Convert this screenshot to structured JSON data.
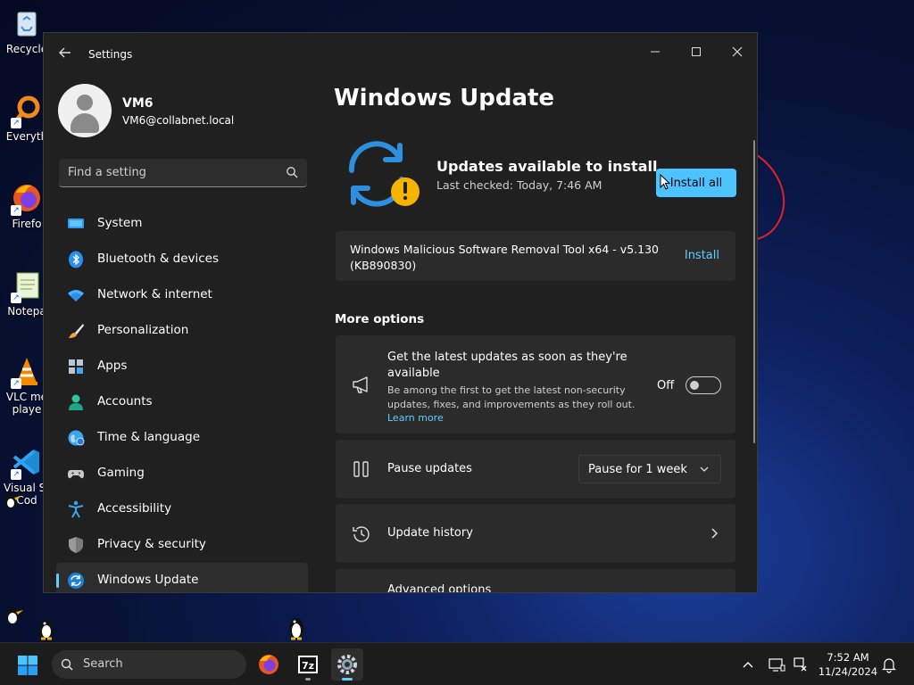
{
  "desktop": {
    "icons": [
      {
        "label": "Recycle"
      },
      {
        "label": "Everyth"
      },
      {
        "label": "Firefo"
      },
      {
        "label": "Notepa"
      },
      {
        "label": "VLC me\nplaye"
      },
      {
        "label": "Visual St\nCod"
      }
    ]
  },
  "window": {
    "title": "Settings",
    "controls": {
      "minimize": "—",
      "maximize": "☐",
      "close": "✕"
    }
  },
  "profile": {
    "name": "VM6",
    "email": "VM6@collabnet.local"
  },
  "search": {
    "placeholder": "Find a setting"
  },
  "nav": {
    "items": [
      {
        "label": "System",
        "icon": "system-icon"
      },
      {
        "label": "Bluetooth & devices",
        "icon": "bluetooth-icon"
      },
      {
        "label": "Network & internet",
        "icon": "wifi-icon"
      },
      {
        "label": "Personalization",
        "icon": "brush-icon"
      },
      {
        "label": "Apps",
        "icon": "apps-icon"
      },
      {
        "label": "Accounts",
        "icon": "person-icon"
      },
      {
        "label": "Time & language",
        "icon": "globe-icon"
      },
      {
        "label": "Gaming",
        "icon": "gamepad-icon"
      },
      {
        "label": "Accessibility",
        "icon": "accessibility-icon"
      },
      {
        "label": "Privacy & security",
        "icon": "shield-icon"
      },
      {
        "label": "Windows Update",
        "icon": "update-icon"
      }
    ],
    "active_index": 10
  },
  "main": {
    "title": "Windows Update",
    "status": {
      "title": "Updates available to install",
      "subtitle": "Last checked: Today, 7:46 AM",
      "install_all_label": "Install all"
    },
    "pending_update": {
      "name": "Windows Malicious Software Removal Tool x64 - v5.130 (KB890830)",
      "action_label": "Install"
    },
    "more_options_label": "More options",
    "latest_updates": {
      "title": "Get the latest updates as soon as they're available",
      "desc_line1": "Be among the first to get the latest non-security",
      "desc_line2": "updates, fixes, and improvements as they roll out.",
      "learn_more": "Learn more",
      "toggle_label": "Off",
      "toggle_on": false
    },
    "pause": {
      "title": "Pause updates",
      "selected": "Pause for 1 week"
    },
    "history": {
      "title": "Update history"
    },
    "advanced": {
      "title": "Advanced options"
    }
  },
  "taskbar": {
    "search_label": "Search",
    "clock": {
      "time": "7:52 AM",
      "date": "11/24/2024"
    }
  },
  "colors": {
    "accent": "#4cc2ff",
    "link": "#60cdff",
    "window_bg": "#202020",
    "card_bg": "#2b2b2b",
    "warning": "#f5b400"
  }
}
